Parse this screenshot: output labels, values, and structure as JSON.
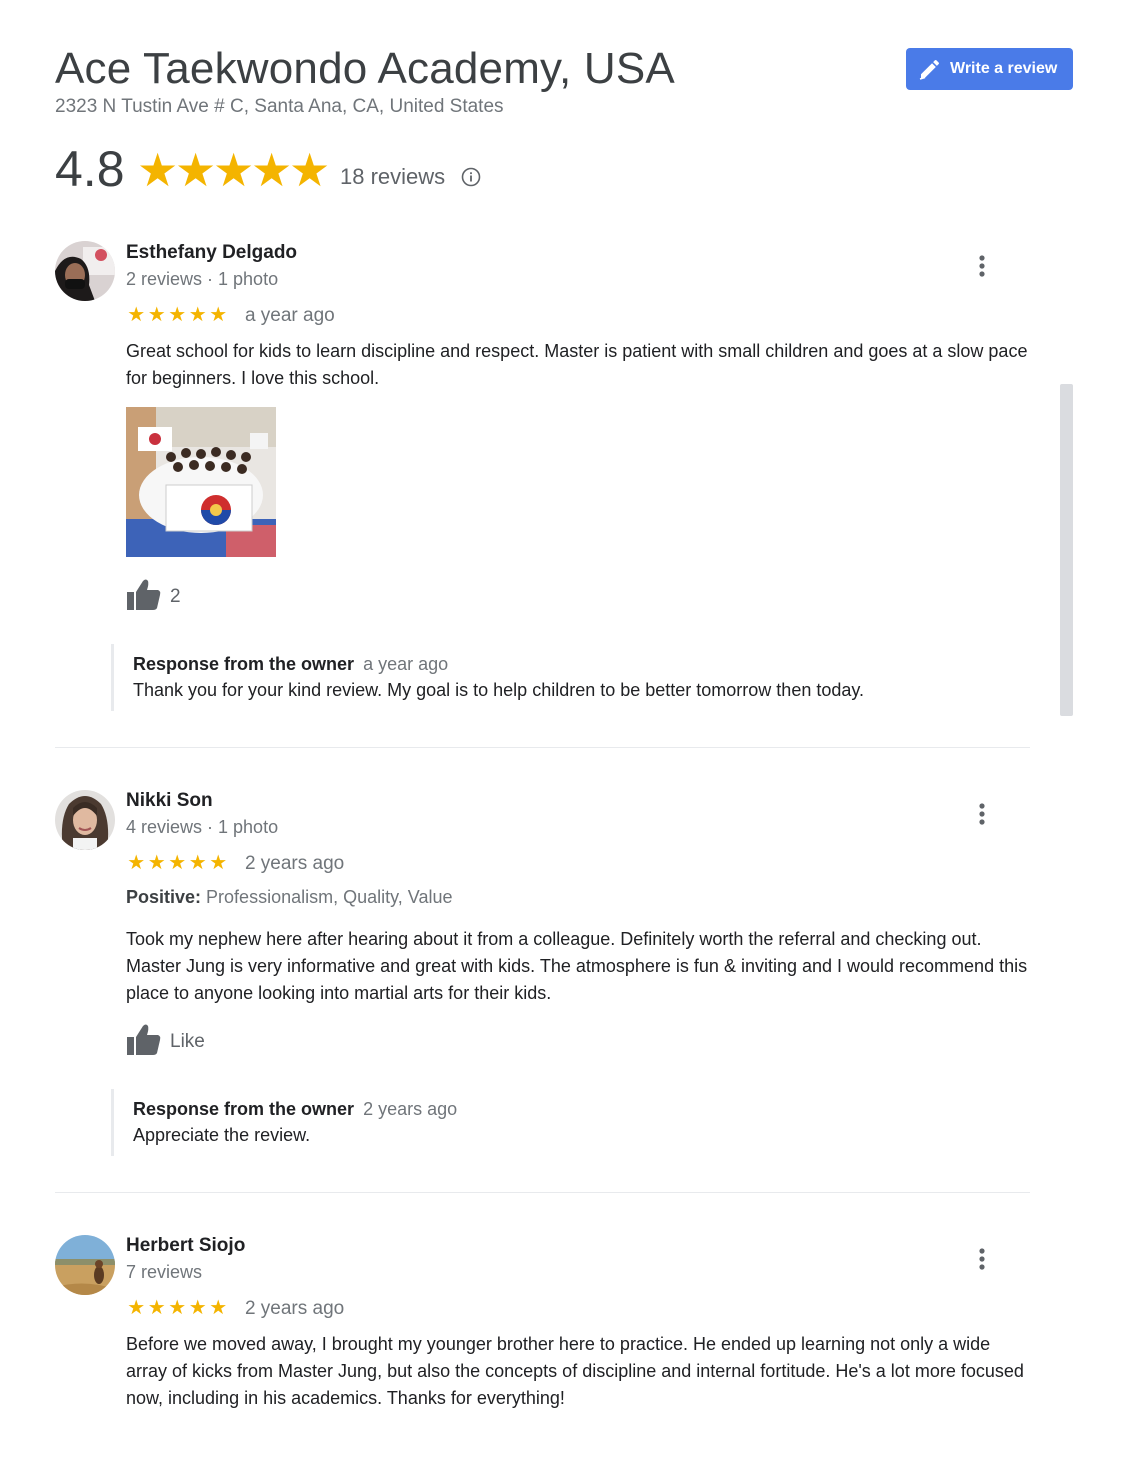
{
  "business": {
    "name": "Ace Taekwondo Academy, USA",
    "address": "2323 N Tustin Ave # C, Santa Ana, CA, United States",
    "rating": "4.8",
    "review_count": "18 reviews",
    "stars": 5
  },
  "write_review_label": "Write a review",
  "reviews": [
    {
      "author": "Esthefany Delgado",
      "meta": "2 reviews · 1 photo",
      "stars": 5,
      "time": "a year ago",
      "text": "Great school for kids to learn discipline and respect. Master is patient with small children and goes at a slow pace for beginners. I love this school.",
      "likes": "2",
      "response_label": "Response from the owner",
      "response_time": "a year ago",
      "response_text": "Thank you for your kind review. My goal is to help children to be better tomorrow then today."
    },
    {
      "author": "Nikki Son",
      "meta": "4 reviews · 1 photo",
      "stars": 5,
      "time": "2 years ago",
      "positive_label": "Positive:",
      "positive_text": "Professionalism, Quality, Value",
      "text": "Took my nephew here after hearing about it from a colleague. Definitely worth the referral and checking out. Master Jung is very informative and great with kids. The atmosphere is fun & inviting and I would recommend this place to anyone looking into martial arts for their kids.",
      "likes": "Like",
      "response_label": "Response from the owner",
      "response_time": "2 years ago",
      "response_text": "Appreciate the review."
    },
    {
      "author": "Herbert Siojo",
      "meta": "7 reviews",
      "stars": 5,
      "time": "2 years ago",
      "text": "Before we moved away, I brought my younger brother here to practice.  He ended up learning not only a wide array of kicks from Master Jung, but also the concepts of discipline and internal fortitude.  He's a lot more focused now, including in his academics.  Thanks for everything!"
    }
  ],
  "colors": {
    "star": "#f4b400",
    "button": "#4a7be8",
    "muted_text": "#70757a"
  },
  "icons": [
    "pencil-icon",
    "info-icon",
    "more-vert-icon",
    "thumbs-up-icon",
    "star-icon"
  ]
}
